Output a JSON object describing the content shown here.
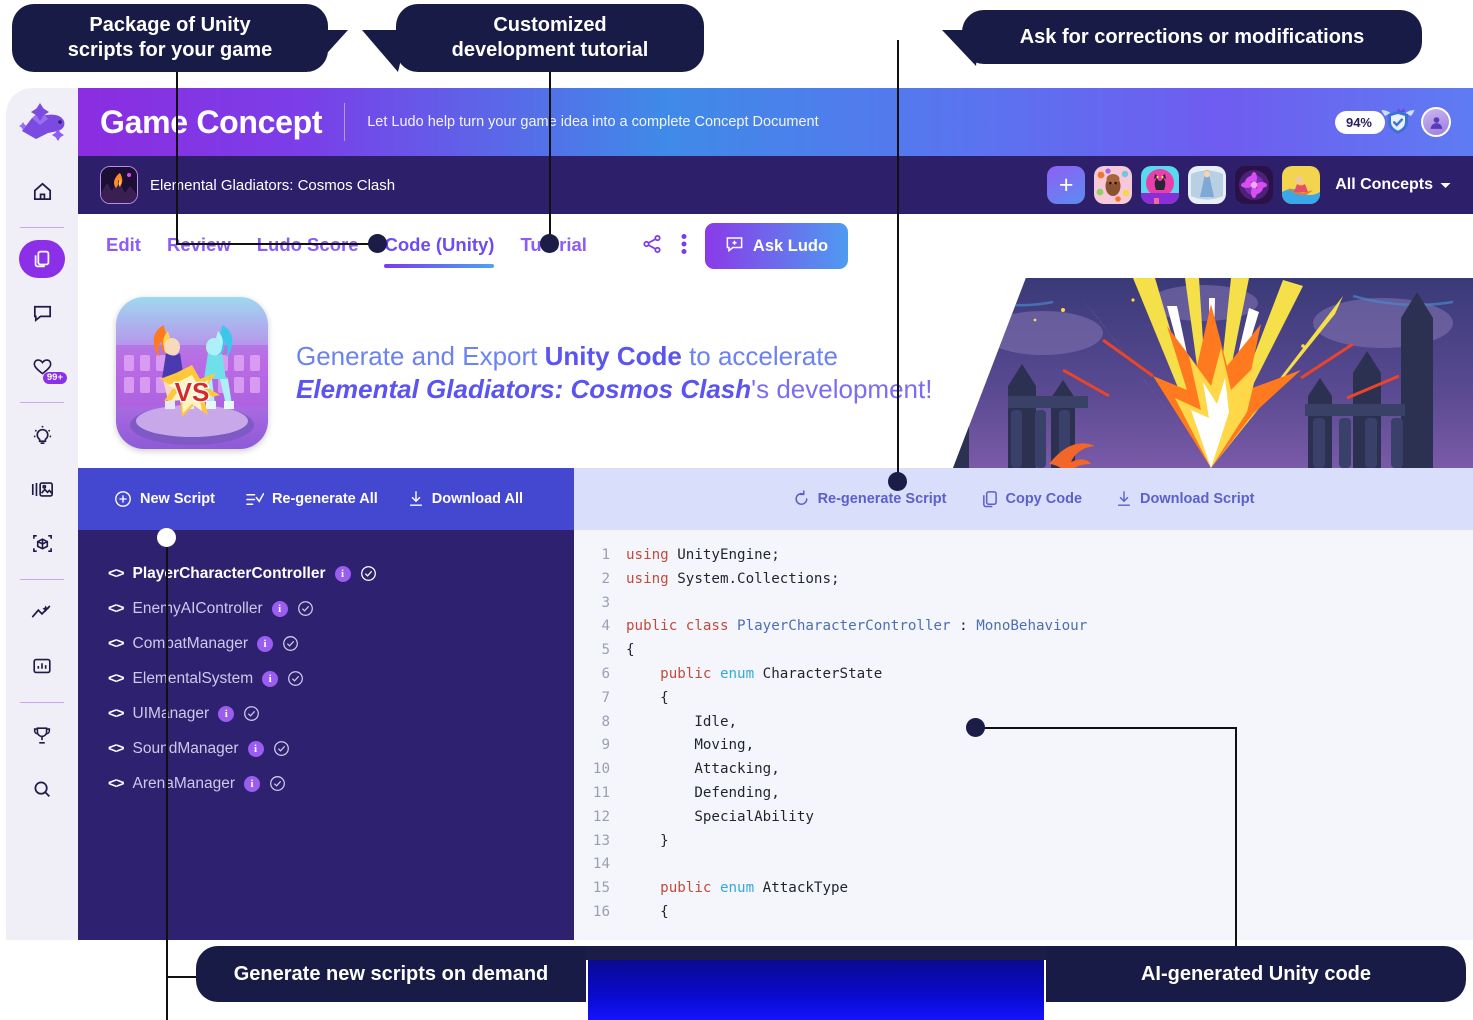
{
  "annotations": [
    {
      "id": "ann-unity-package",
      "text": "Package of Unity\nscripts for your game"
    },
    {
      "id": "ann-tutorial",
      "text": "Customized\ndevelopment tutorial"
    },
    {
      "id": "ann-corrections",
      "text": "Ask for corrections or modifications"
    },
    {
      "id": "ann-new-scripts",
      "text": "Generate new scripts on demand"
    },
    {
      "id": "ann-ai-code",
      "text": "AI-generated Unity code"
    }
  ],
  "sidebar": {
    "items": [
      {
        "name": "ludo-logo",
        "label": "Ludo"
      },
      {
        "name": "home",
        "label": "Home"
      },
      {
        "name": "concepts",
        "label": "Concepts"
      },
      {
        "name": "chat",
        "label": "Chat"
      },
      {
        "name": "favorites",
        "label": "Favorites",
        "badge": "99+"
      },
      {
        "name": "ideas",
        "label": "Ideas"
      },
      {
        "name": "gallery",
        "label": "Gallery"
      },
      {
        "name": "assets-3d",
        "label": "3D Assets"
      },
      {
        "name": "trends",
        "label": "Trends"
      },
      {
        "name": "analytics",
        "label": "Analytics"
      },
      {
        "name": "awards",
        "label": "Top Charts"
      },
      {
        "name": "search",
        "label": "Search"
      }
    ]
  },
  "header": {
    "title": "Game Concept",
    "subtitle": "Let Ludo help turn your game idea into a complete Concept Document",
    "score_pct": "94%",
    "shield_icon": "verified-shield-icon",
    "avatar_icon": "user-avatar-icon"
  },
  "concept_bar": {
    "concept_name": "Elemental Gladiators: Cosmos Clash",
    "add_label": "+",
    "all_concepts_label": "All Concepts",
    "thumbnails": [
      "candy-concept",
      "cat-concept",
      "princess-concept",
      "flower-concept",
      "surf-concept"
    ]
  },
  "tabs": {
    "items": [
      {
        "label": "Edit",
        "active": false
      },
      {
        "label": "Review",
        "active": false
      },
      {
        "label": "Ludo Score",
        "active": false
      },
      {
        "label": "Code (Unity)",
        "active": true
      },
      {
        "label": "Tutorial",
        "active": false
      }
    ],
    "share_icon": "share-icon",
    "more_icon": "more-vertical-icon",
    "ask_ludo_label": "Ask Ludo",
    "ask_ludo_icon": "chat-plus-icon"
  },
  "hero": {
    "line1_a": "Generate and Export ",
    "line1_b": "Unity Code",
    "line1_c": " to accelerate",
    "line2_a": "Elemental Gladiators: Cosmos Clash",
    "line2_b": "'s development!"
  },
  "left_toolbar": {
    "items": [
      {
        "label": "New Script",
        "icon": "plus-circle-icon"
      },
      {
        "label": "Re-generate All",
        "icon": "regenerate-list-icon"
      },
      {
        "label": "Download All",
        "icon": "download-icon"
      }
    ]
  },
  "right_toolbar": {
    "items": [
      {
        "label": "Re-generate Script",
        "icon": "refresh-icon"
      },
      {
        "label": "Copy Code",
        "icon": "copy-icon"
      },
      {
        "label": "Download Script",
        "icon": "download-icon"
      }
    ]
  },
  "scripts": {
    "items": [
      {
        "name": "PlayerCharacterController",
        "selected": true
      },
      {
        "name": "EnemyAIController",
        "selected": false
      },
      {
        "name": "CombatManager",
        "selected": false
      },
      {
        "name": "ElementalSystem",
        "selected": false
      },
      {
        "name": "UIManager",
        "selected": false
      },
      {
        "name": "SoundManager",
        "selected": false
      },
      {
        "name": "ArenaManager",
        "selected": false
      }
    ]
  },
  "code": {
    "language": "csharp",
    "lines": [
      {
        "n": "1",
        "tokens": [
          {
            "t": "using",
            "c": "kw"
          },
          {
            "t": " UnityEngine;",
            "c": "pln"
          }
        ]
      },
      {
        "n": "2",
        "tokens": [
          {
            "t": "using",
            "c": "kw"
          },
          {
            "t": " System.Collections;",
            "c": "pln"
          }
        ]
      },
      {
        "n": "3",
        "tokens": []
      },
      {
        "n": "4",
        "tokens": [
          {
            "t": "public class ",
            "c": "kw"
          },
          {
            "t": "PlayerCharacterController",
            "c": "typ"
          },
          {
            "t": " : ",
            "c": "pln"
          },
          {
            "t": "MonoBehaviour",
            "c": "typ"
          }
        ]
      },
      {
        "n": "5",
        "tokens": [
          {
            "t": "{",
            "c": "pln"
          }
        ]
      },
      {
        "n": "6",
        "tokens": [
          {
            "t": "    ",
            "c": "pln"
          },
          {
            "t": "public ",
            "c": "kw"
          },
          {
            "t": "enum",
            "c": "kw2"
          },
          {
            "t": " CharacterState",
            "c": "pln"
          }
        ]
      },
      {
        "n": "7",
        "tokens": [
          {
            "t": "    {",
            "c": "pln"
          }
        ]
      },
      {
        "n": "8",
        "tokens": [
          {
            "t": "        Idle,",
            "c": "pln"
          }
        ]
      },
      {
        "n": "9",
        "tokens": [
          {
            "t": "        Moving,",
            "c": "pln"
          }
        ]
      },
      {
        "n": "10",
        "tokens": [
          {
            "t": "        Attacking,",
            "c": "pln"
          }
        ]
      },
      {
        "n": "11",
        "tokens": [
          {
            "t": "        Defending,",
            "c": "pln"
          }
        ]
      },
      {
        "n": "12",
        "tokens": [
          {
            "t": "        SpecialAbility",
            "c": "pln"
          }
        ]
      },
      {
        "n": "13",
        "tokens": [
          {
            "t": "    }",
            "c": "pln"
          }
        ]
      },
      {
        "n": "14",
        "tokens": []
      },
      {
        "n": "15",
        "tokens": [
          {
            "t": "    ",
            "c": "pln"
          },
          {
            "t": "public ",
            "c": "kw"
          },
          {
            "t": "enum",
            "c": "kw2"
          },
          {
            "t": " AttackType",
            "c": "pln"
          }
        ]
      },
      {
        "n": "16",
        "tokens": [
          {
            "t": "    {",
            "c": "pln"
          }
        ]
      }
    ]
  },
  "colors": {
    "accent_purple": "#8b2fe8",
    "deep_navy": "#181b45",
    "panel_indigo": "#2e2170",
    "toolbar_blue": "#4447cf",
    "toolbar_light": "#d9dffa",
    "tab_active": "#6d4df0"
  }
}
